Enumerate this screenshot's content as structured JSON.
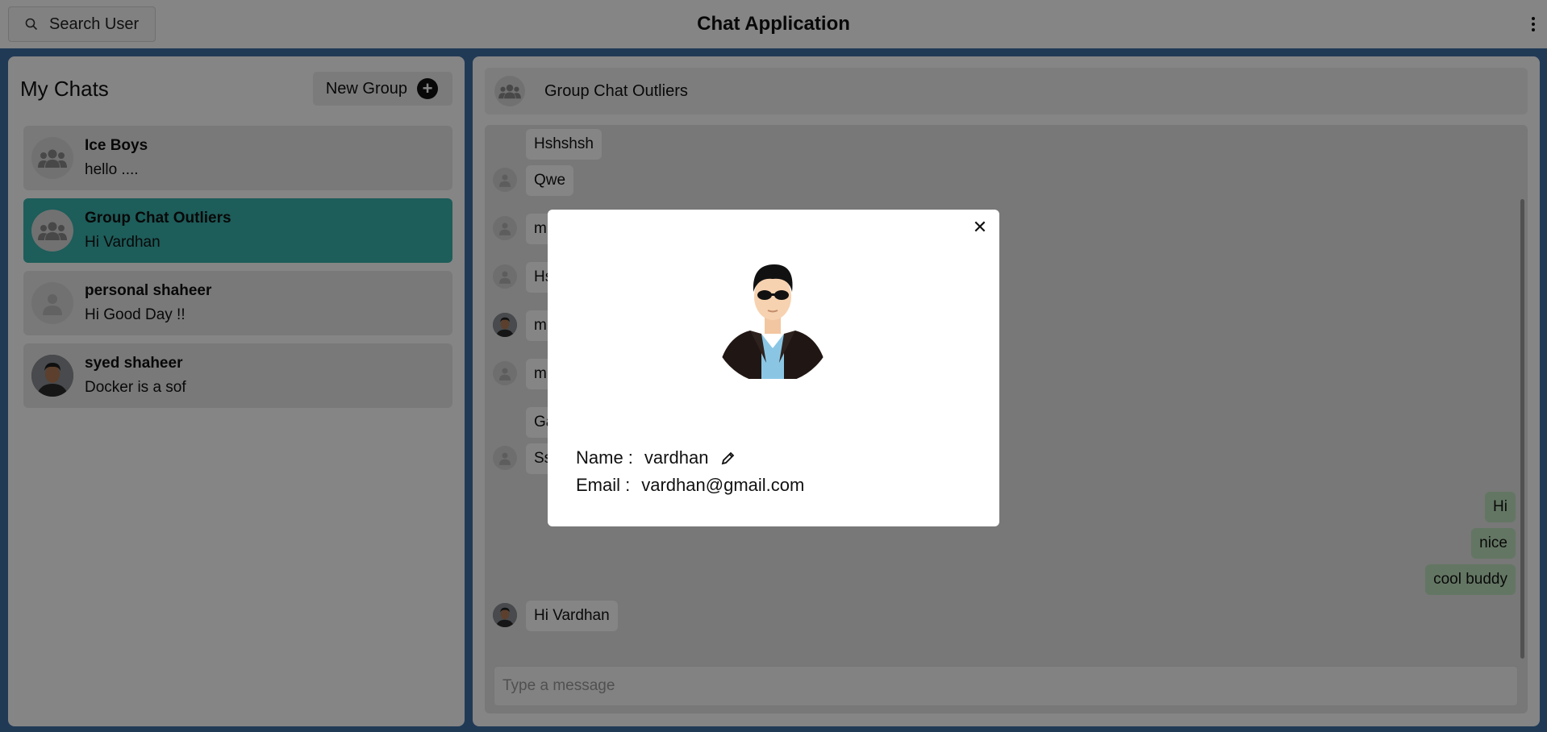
{
  "topbar": {
    "search_label": "Search User",
    "app_title": "Chat Application"
  },
  "sidebar": {
    "title": "My Chats",
    "new_group_label": "New Group",
    "chats": [
      {
        "name": "Ice Boys",
        "preview": "hello ....",
        "avatar": "group-icon",
        "active": false
      },
      {
        "name": "Group Chat Outliers",
        "preview": "Hi Vardhan",
        "avatar": "group-icon",
        "active": true
      },
      {
        "name": "personal shaheer",
        "preview": "Hi Good Day !!",
        "avatar": "user-icon",
        "active": false
      },
      {
        "name": "syed shaheer",
        "preview": "Docker is a sof",
        "avatar": "user-photo",
        "active": false
      }
    ]
  },
  "chat": {
    "title": "Group Chat Outliers",
    "messages": [
      {
        "text": "Hshshsh"
      },
      {
        "text": "Qwe"
      },
      {
        "text": "m"
      },
      {
        "text": "Hs"
      },
      {
        "text": "m"
      },
      {
        "text": "m"
      },
      {
        "text": "Ga"
      },
      {
        "text": "Ss"
      },
      {
        "text": "Hi"
      },
      {
        "text": "nice"
      },
      {
        "text": "cool buddy"
      },
      {
        "text": "Hi Vardhan"
      }
    ],
    "input_placeholder": "Type a message"
  },
  "profile_modal": {
    "name_label": "Name :",
    "name_value": "vardhan",
    "email_label": "Email :",
    "email_value": "vardhan@gmail.com"
  },
  "colors": {
    "active_chat": "#38b2ac",
    "own_message": "#bee3be",
    "page_background": "#3f6fa6"
  }
}
